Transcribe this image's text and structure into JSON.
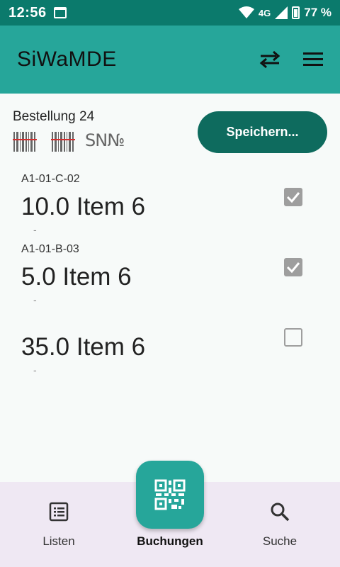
{
  "status_bar": {
    "time": "12:56",
    "network": "4G",
    "battery": "77 %"
  },
  "app_bar": {
    "title": "SiWaMDE"
  },
  "order": {
    "title": "Bestellung 24",
    "sn_label": "SN№",
    "save_label": "Speichern..."
  },
  "items": [
    {
      "location": "A1-01-C-02",
      "text": "10.0 Item 6",
      "sub": "-",
      "checked": true
    },
    {
      "location": "A1-01-B-03",
      "text": "5.0 Item 6",
      "sub": "-",
      "checked": true
    },
    {
      "location": "",
      "text": "35.0 Item 6",
      "sub": "-",
      "checked": false
    }
  ],
  "nav": {
    "lists_label": "Listen",
    "bookings_label": "Buchungen",
    "search_label": "Suche",
    "active": "bookings"
  },
  "colors": {
    "status_bar": "#0b7a6c",
    "app_bar": "#26a69a",
    "save_button": "#0e6b5e",
    "checkbox": "#9e9e9e",
    "bottom_nav": "#efe8f3"
  }
}
